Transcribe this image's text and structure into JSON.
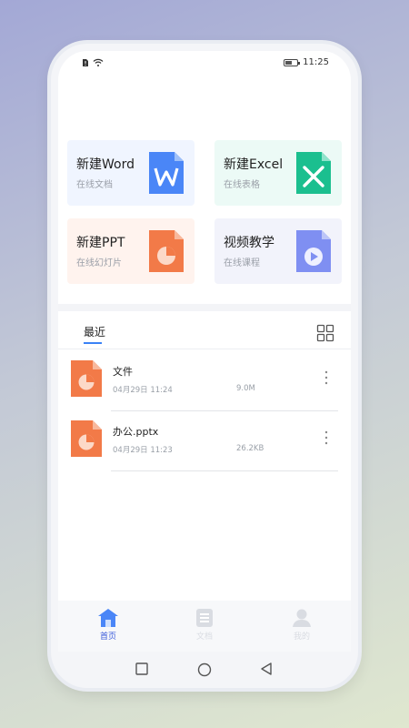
{
  "status_bar": {
    "time": "11:25",
    "battery": 0.6
  },
  "cards": [
    {
      "title": "新建Word",
      "subtitle": "在线文档",
      "icon": "word-doc-icon",
      "color": "#4a86f7"
    },
    {
      "title": "新建Excel",
      "subtitle": "在线表格",
      "icon": "excel-sheet-icon",
      "color": "#1bbf8f"
    },
    {
      "title": "新建PPT",
      "subtitle": "在线幻灯片",
      "icon": "ppt-slide-icon",
      "color": "#f27a48"
    },
    {
      "title": "视频教学",
      "subtitle": "在线课程",
      "icon": "video-play-icon",
      "color": "#7f8ff2"
    }
  ],
  "tabs": {
    "recent": "最近",
    "grid_icon": "grid-view-icon"
  },
  "files": [
    {
      "name": "文件",
      "date": "04月29日 11:24",
      "size": "9.0M",
      "icon": "ppt-file-icon"
    },
    {
      "name": "办公.pptx",
      "date": "04月29日 11:23",
      "size": "26.2KB",
      "icon": "ppt-file-icon"
    }
  ],
  "bottom_nav": [
    {
      "label": "首页",
      "icon": "home-icon",
      "active": true
    },
    {
      "label": "文档",
      "icon": "document-icon",
      "active": false
    },
    {
      "label": "我的",
      "icon": "user-icon",
      "active": false
    }
  ],
  "colors": {
    "accent": "#3b82f6",
    "active_nav": "#3b5bdb",
    "ppt": "#f27a48"
  }
}
